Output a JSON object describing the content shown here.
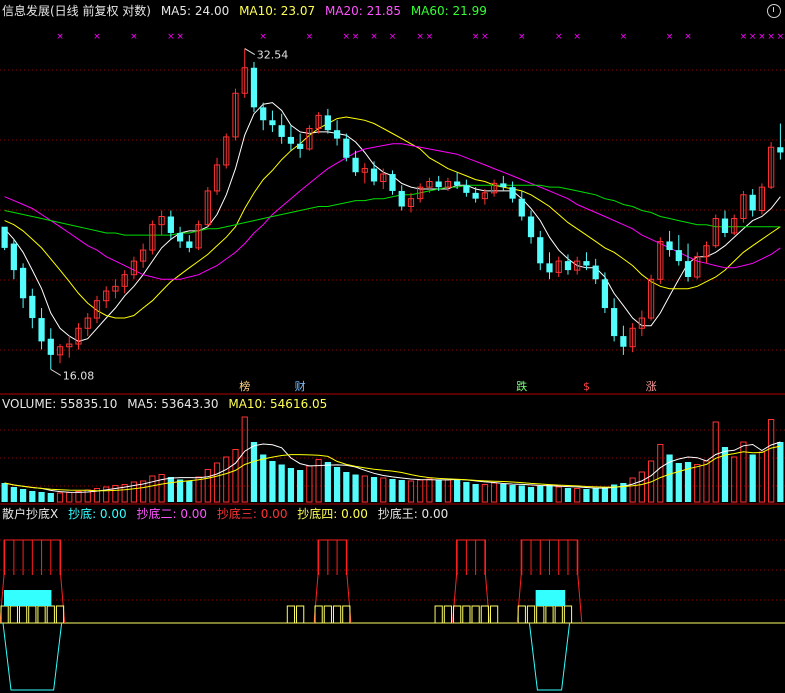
{
  "header": {
    "title": "信息发展(日线 前复权 对数)",
    "ma5": "MA5: 24.00",
    "ma10": "MA10: 23.07",
    "ma20": "MA20: 21.85",
    "ma60": "MA60: 21.99"
  },
  "price_annotations": {
    "high": "32.54",
    "low": "16.08"
  },
  "event_markers": [
    {
      "text": "榜",
      "color": "#ffd27f"
    },
    {
      "text": "财",
      "color": "#7fbfff"
    },
    {
      "text": "跌",
      "color": "#7fff7f"
    },
    {
      "text": "$",
      "color": "#ff4040"
    },
    {
      "text": "涨",
      "color": "#ff9a9a"
    }
  ],
  "volume_header": {
    "volume": "VOLUME: 55835.10",
    "ma5": "MA5: 53643.30",
    "ma10": "MA10: 54616.05"
  },
  "indicator_header": {
    "name": "散户抄底X",
    "s1": "抄底: 0.00",
    "s2": "抄底二: 0.00",
    "s3": "抄底三: 0.00",
    "s4": "抄底四: 0.00",
    "s5": "抄底王: 0.00"
  },
  "colors": {
    "up": "#ff3232",
    "down": "#54fcfc",
    "ma5": "#ffffff",
    "ma10": "#ffff00",
    "ma20": "#ff00ff",
    "ma60": "#00dd00",
    "grid": "#8b0000",
    "divider": "#b00000"
  },
  "chart_data": {
    "type": "candlestick",
    "ohlc": [
      [
        22.0,
        21.8,
        20.9,
        21.0
      ],
      [
        21.2,
        21.4,
        19.6,
        20.0
      ],
      [
        20.1,
        20.3,
        18.4,
        18.8
      ],
      [
        18.9,
        19.2,
        17.6,
        18.0
      ],
      [
        18.0,
        18.4,
        16.8,
        17.1
      ],
      [
        17.2,
        17.6,
        16.08,
        16.6
      ],
      [
        16.6,
        17.0,
        16.3,
        16.9
      ],
      [
        16.9,
        17.3,
        16.5,
        17.0
      ],
      [
        17.0,
        17.8,
        16.8,
        17.6
      ],
      [
        17.6,
        18.2,
        17.3,
        18.0
      ],
      [
        18.0,
        18.9,
        17.8,
        18.7
      ],
      [
        18.7,
        19.3,
        18.4,
        19.1
      ],
      [
        19.1,
        19.6,
        18.8,
        19.3
      ],
      [
        19.3,
        20.0,
        19.0,
        19.8
      ],
      [
        19.8,
        20.6,
        19.6,
        20.4
      ],
      [
        20.4,
        21.2,
        20.1,
        20.9
      ],
      [
        20.9,
        22.3,
        20.7,
        22.1
      ],
      [
        22.1,
        22.8,
        21.6,
        22.5
      ],
      [
        22.5,
        22.8,
        21.4,
        21.7
      ],
      [
        21.7,
        22.0,
        21.0,
        21.3
      ],
      [
        21.3,
        21.6,
        20.8,
        21.0
      ],
      [
        21.0,
        22.3,
        20.9,
        22.1
      ],
      [
        22.1,
        24.0,
        22.0,
        23.8
      ],
      [
        23.8,
        25.6,
        23.6,
        25.2
      ],
      [
        25.2,
        27.0,
        25.0,
        26.8
      ],
      [
        26.8,
        29.8,
        26.6,
        29.5
      ],
      [
        29.5,
        32.54,
        29.2,
        31.2
      ],
      [
        31.2,
        31.6,
        28.3,
        28.6
      ],
      [
        28.6,
        28.9,
        27.2,
        27.8
      ],
      [
        27.8,
        28.4,
        27.1,
        27.5
      ],
      [
        27.5,
        28.2,
        26.4,
        26.8
      ],
      [
        26.8,
        27.5,
        26.0,
        26.4
      ],
      [
        26.4,
        27.0,
        25.6,
        26.1
      ],
      [
        26.1,
        27.5,
        26.0,
        27.3
      ],
      [
        27.3,
        28.3,
        27.0,
        28.1
      ],
      [
        28.1,
        28.5,
        27.0,
        27.2
      ],
      [
        27.2,
        27.8,
        26.3,
        26.7
      ],
      [
        26.7,
        27.0,
        25.4,
        25.6
      ],
      [
        25.6,
        26.0,
        24.6,
        24.8
      ],
      [
        24.8,
        25.3,
        24.2,
        25.0
      ],
      [
        25.0,
        25.4,
        24.1,
        24.3
      ],
      [
        24.3,
        25.0,
        23.9,
        24.7
      ],
      [
        24.7,
        24.9,
        23.6,
        23.8
      ],
      [
        23.8,
        24.1,
        22.8,
        23.0
      ],
      [
        23.0,
        23.7,
        22.7,
        23.4
      ],
      [
        23.4,
        24.2,
        23.2,
        24.0
      ],
      [
        24.0,
        24.5,
        23.7,
        24.3
      ],
      [
        24.3,
        24.6,
        23.8,
        24.0
      ],
      [
        24.0,
        24.5,
        23.8,
        24.3
      ],
      [
        24.3,
        24.8,
        23.9,
        24.1
      ],
      [
        24.1,
        24.4,
        23.5,
        23.7
      ],
      [
        23.7,
        24.0,
        23.2,
        23.4
      ],
      [
        23.4,
        23.9,
        23.1,
        23.7
      ],
      [
        23.7,
        24.4,
        23.5,
        24.2
      ],
      [
        24.2,
        24.6,
        23.8,
        24.0
      ],
      [
        24.0,
        24.3,
        23.2,
        23.4
      ],
      [
        23.4,
        23.8,
        22.3,
        22.5
      ],
      [
        22.5,
        22.8,
        21.2,
        21.5
      ],
      [
        21.5,
        21.8,
        20.0,
        20.3
      ],
      [
        20.3,
        20.8,
        19.6,
        19.9
      ],
      [
        19.9,
        20.6,
        19.7,
        20.4
      ],
      [
        20.4,
        20.7,
        19.8,
        20.0
      ],
      [
        20.0,
        20.6,
        19.8,
        20.4
      ],
      [
        20.4,
        20.8,
        20.0,
        20.2
      ],
      [
        20.2,
        20.5,
        19.4,
        19.6
      ],
      [
        19.6,
        19.9,
        18.2,
        18.4
      ],
      [
        18.4,
        18.8,
        17.1,
        17.3
      ],
      [
        17.3,
        17.7,
        16.6,
        16.9
      ],
      [
        16.9,
        17.8,
        16.7,
        17.6
      ],
      [
        17.6,
        18.3,
        17.3,
        18.0
      ],
      [
        18.0,
        19.8,
        17.9,
        19.6
      ],
      [
        19.6,
        21.5,
        19.4,
        21.3
      ],
      [
        21.3,
        21.8,
        20.6,
        20.9
      ],
      [
        20.9,
        21.6,
        20.2,
        20.4
      ],
      [
        20.4,
        21.2,
        19.5,
        19.7
      ],
      [
        19.7,
        20.8,
        19.6,
        20.6
      ],
      [
        20.6,
        21.3,
        20.3,
        21.1
      ],
      [
        21.1,
        22.6,
        21.0,
        22.4
      ],
      [
        22.4,
        22.8,
        21.5,
        21.7
      ],
      [
        21.7,
        22.6,
        21.6,
        22.4
      ],
      [
        22.4,
        23.8,
        22.2,
        23.6
      ],
      [
        23.6,
        23.9,
        22.5,
        22.8
      ],
      [
        22.8,
        24.2,
        22.6,
        24.0
      ],
      [
        24.0,
        26.5,
        23.9,
        26.2
      ],
      [
        26.2,
        27.6,
        25.5,
        25.9
      ]
    ],
    "ylim": [
      15.3,
      34.5
    ],
    "ma_lines": {
      "MA5": [
        21.9,
        21.4,
        20.8,
        20.0,
        19.2,
        18.2,
        17.6,
        17.3,
        17.1,
        17.2,
        17.6,
        18.0,
        18.4,
        18.9,
        19.3,
        19.8,
        20.4,
        21.0,
        21.4,
        21.7,
        21.8,
        21.8,
        22.0,
        22.6,
        23.6,
        25.0,
        26.9,
        28.2,
        28.8,
        28.9,
        28.4,
        27.5,
        27.1,
        27.0,
        27.1,
        27.1,
        27.0,
        26.9,
        26.5,
        25.9,
        25.2,
        24.8,
        24.6,
        24.2,
        24.0,
        23.9,
        23.9,
        23.9,
        23.9,
        24.1,
        24.1,
        23.9,
        23.8,
        23.8,
        23.8,
        23.8,
        23.4,
        22.9,
        22.3,
        21.5,
        20.9,
        20.5,
        20.2,
        20.1,
        20.1,
        19.7,
        19.0,
        18.5,
        18.0,
        17.7,
        17.7,
        18.2,
        18.9,
        19.6,
        20.3,
        20.6,
        20.6,
        20.8,
        21.1,
        21.5,
        21.9,
        22.3,
        22.5,
        22.9,
        23.5
      ],
      "MA10": [
        22.3,
        22.1,
        21.8,
        21.4,
        21.0,
        20.5,
        20.0,
        19.5,
        19.0,
        18.6,
        18.3,
        18.1,
        18.0,
        18.0,
        18.1,
        18.4,
        18.7,
        19.1,
        19.5,
        19.8,
        20.1,
        20.4,
        20.7,
        21.1,
        21.5,
        22.0,
        22.9,
        23.7,
        24.4,
        24.9,
        25.5,
        26.0,
        26.4,
        26.9,
        27.3,
        27.6,
        27.9,
        28.0,
        27.9,
        27.8,
        27.6,
        27.3,
        27.0,
        26.7,
        26.4,
        26.1,
        25.6,
        25.3,
        25.0,
        24.8,
        24.6,
        24.4,
        24.3,
        24.1,
        24.0,
        23.9,
        23.8,
        23.6,
        23.3,
        23.0,
        22.6,
        22.2,
        21.9,
        21.6,
        21.3,
        21.0,
        20.8,
        20.5,
        20.2,
        19.8,
        19.5,
        19.3,
        19.2,
        19.2,
        19.2,
        19.3,
        19.5,
        19.7,
        20.0,
        20.4,
        20.8,
        21.1,
        21.4,
        21.7,
        22.0
      ],
      "MA20": [
        23.5,
        23.3,
        23.1,
        22.9,
        22.6,
        22.3,
        22.0,
        21.7,
        21.4,
        21.1,
        20.9,
        20.6,
        20.4,
        20.2,
        20.0,
        19.8,
        19.7,
        19.6,
        19.6,
        19.6,
        19.7,
        19.8,
        20.0,
        20.2,
        20.5,
        20.8,
        21.2,
        21.7,
        22.1,
        22.6,
        23.0,
        23.4,
        23.8,
        24.2,
        24.6,
        25.0,
        25.3,
        25.6,
        25.9,
        26.1,
        26.2,
        26.3,
        26.4,
        26.4,
        26.3,
        26.2,
        26.1,
        26.0,
        25.9,
        25.8,
        25.6,
        25.4,
        25.2,
        25.0,
        24.8,
        24.6,
        24.4,
        24.2,
        24.0,
        23.8,
        23.6,
        23.4,
        23.1,
        22.9,
        22.7,
        22.5,
        22.3,
        22.1,
        21.9,
        21.6,
        21.4,
        21.2,
        21.0,
        20.8,
        20.6,
        20.4,
        20.3,
        20.2,
        20.1,
        20.1,
        20.2,
        20.3,
        20.5,
        20.7,
        21.0
      ],
      "MA60": [
        22.8,
        22.7,
        22.6,
        22.5,
        22.4,
        22.3,
        22.2,
        22.1,
        22.0,
        21.9,
        21.8,
        21.7,
        21.7,
        21.6,
        21.6,
        21.6,
        21.6,
        21.6,
        21.6,
        21.7,
        21.7,
        21.8,
        21.9,
        21.9,
        22.0,
        22.1,
        22.2,
        22.3,
        22.4,
        22.5,
        22.6,
        22.7,
        22.8,
        22.9,
        23.0,
        23.0,
        23.1,
        23.2,
        23.3,
        23.3,
        23.4,
        23.4,
        23.5,
        23.6,
        23.6,
        23.7,
        23.8,
        23.9,
        24.0,
        24.0,
        24.1,
        24.1,
        24.1,
        24.1,
        24.1,
        24.1,
        24.1,
        24.1,
        24.1,
        24.0,
        24.0,
        23.9,
        23.8,
        23.7,
        23.6,
        23.4,
        23.3,
        23.1,
        23.0,
        22.8,
        22.7,
        22.5,
        22.4,
        22.3,
        22.2,
        22.1,
        22.1,
        22.0,
        22.0,
        22.0,
        22.0,
        22.0,
        22.0,
        22.0,
        21.99
      ]
    },
    "volume": [
      38,
      30,
      26,
      22,
      20,
      18,
      18,
      19,
      21,
      24,
      27,
      30,
      33,
      35,
      40,
      42,
      52,
      55,
      50,
      45,
      42,
      50,
      65,
      78,
      90,
      105,
      170,
      120,
      95,
      82,
      75,
      68,
      64,
      72,
      85,
      80,
      70,
      60,
      55,
      52,
      50,
      48,
      46,
      44,
      42,
      44,
      46,
      45,
      44,
      46,
      40,
      36,
      35,
      38,
      36,
      34,
      33,
      30,
      32,
      34,
      30,
      28,
      27,
      26,
      28,
      30,
      35,
      38,
      48,
      60,
      82,
      115,
      95,
      78,
      80,
      75,
      82,
      160,
      110,
      90,
      120,
      95,
      100,
      165,
      120
    ],
    "volume_ylim": [
      0,
      180
    ],
    "indicator": {
      "s1_cyan_block": [
        1,
        1,
        1,
        1,
        1,
        1,
        1,
        1,
        1,
        1,
        1,
        1,
        0,
        0,
        0,
        0,
        0,
        0,
        0,
        0,
        0,
        0,
        0,
        0,
        0,
        0,
        0,
        0,
        0,
        0,
        0,
        0,
        0,
        0,
        0,
        0,
        0,
        0,
        0,
        0,
        0,
        0,
        0,
        0,
        0,
        0,
        0,
        0,
        0,
        0,
        0,
        0,
        0,
        0,
        0,
        0,
        0,
        0,
        0,
        0,
        0,
        0,
        0,
        0,
        0,
        0,
        0,
        0,
        0,
        0,
        0,
        0,
        0,
        0,
        0,
        0,
        0,
        0,
        0,
        0,
        0,
        0,
        0,
        0,
        0
      ],
      "s3_red_bars": [
        1,
        1,
        1,
        1,
        1,
        1,
        1,
        1,
        1,
        1,
        1,
        1,
        1,
        0,
        0,
        0,
        0,
        0,
        0,
        0,
        0,
        0,
        0,
        0,
        0,
        0,
        0,
        0,
        0,
        0,
        0,
        0,
        0,
        0,
        0,
        0,
        0,
        0,
        0,
        0,
        0,
        0,
        0,
        0,
        0,
        0,
        0,
        0,
        0,
        0,
        0,
        0,
        0,
        0,
        0,
        0,
        0,
        0,
        0,
        0,
        0,
        0,
        0,
        0,
        0,
        0,
        0,
        0,
        0,
        0,
        0,
        0,
        0,
        0,
        0,
        0,
        0,
        0,
        0,
        0,
        0,
        0,
        0,
        0,
        0
      ]
    }
  }
}
